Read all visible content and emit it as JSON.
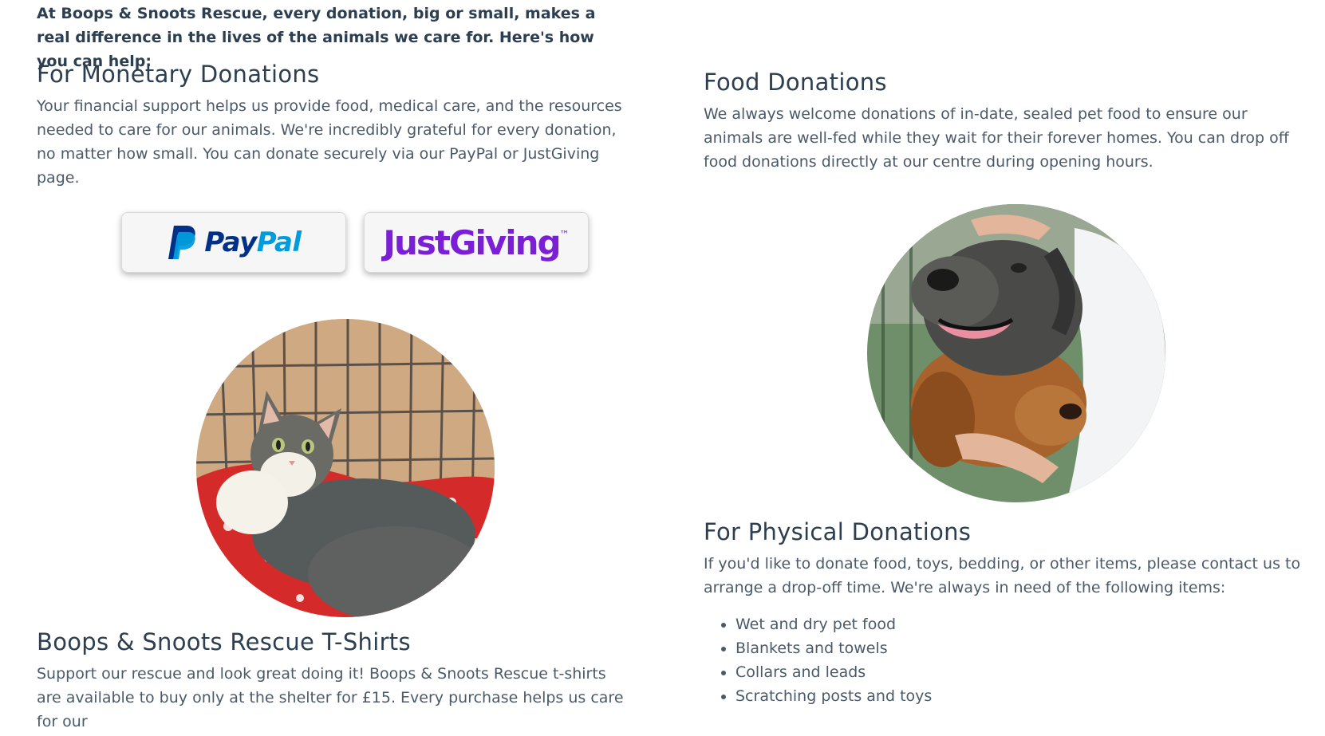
{
  "intro": "At Boops & Snoots Rescue, every donation, big or small, makes a real difference in the lives of the animals we care for. Here's how you can help:",
  "monetary": {
    "heading": "For Monetary Donations",
    "body": "Your financial support helps us provide food, medical care, and the resources needed to care for our animals. We're incredibly grateful for every donation, no matter how small. You can donate securely via our PayPal or JustGiving page."
  },
  "buttons": {
    "paypal_label_pay": "Pay",
    "paypal_label_pal": "Pal",
    "justgiving_label": "JustGiving",
    "justgiving_tm": "™"
  },
  "images": {
    "kitten": "kitten-in-cage-photo",
    "dogs": "dogs-with-volunteer-photo"
  },
  "tshirts": {
    "heading": "Boops & Snoots Rescue T-Shirts",
    "body": "Support our rescue and look great doing it! Boops & Snoots Rescue t-shirts are available to buy only at the shelter for £15. Every purchase helps us care for our"
  },
  "food": {
    "heading": "Food Donations",
    "body": "We always welcome donations of in-date, sealed pet food to ensure our animals are well-fed while they wait for their forever homes. You can drop off food donations directly at our centre during opening hours."
  },
  "physical": {
    "heading": "For Physical Donations",
    "body": "If you'd like to donate food, toys, bedding, or other items, please contact us to arrange a drop-off time. We're always in need of the following items:",
    "items": [
      "Wet and dry pet food",
      "Blankets and towels",
      "Collars and leads",
      "Scratching posts and toys"
    ]
  },
  "colors": {
    "heading": "#2c3e50",
    "body": "#4a5a6a",
    "paypal_dark": "#003087",
    "paypal_light": "#009cde",
    "justgiving": "#7a1fd6"
  }
}
